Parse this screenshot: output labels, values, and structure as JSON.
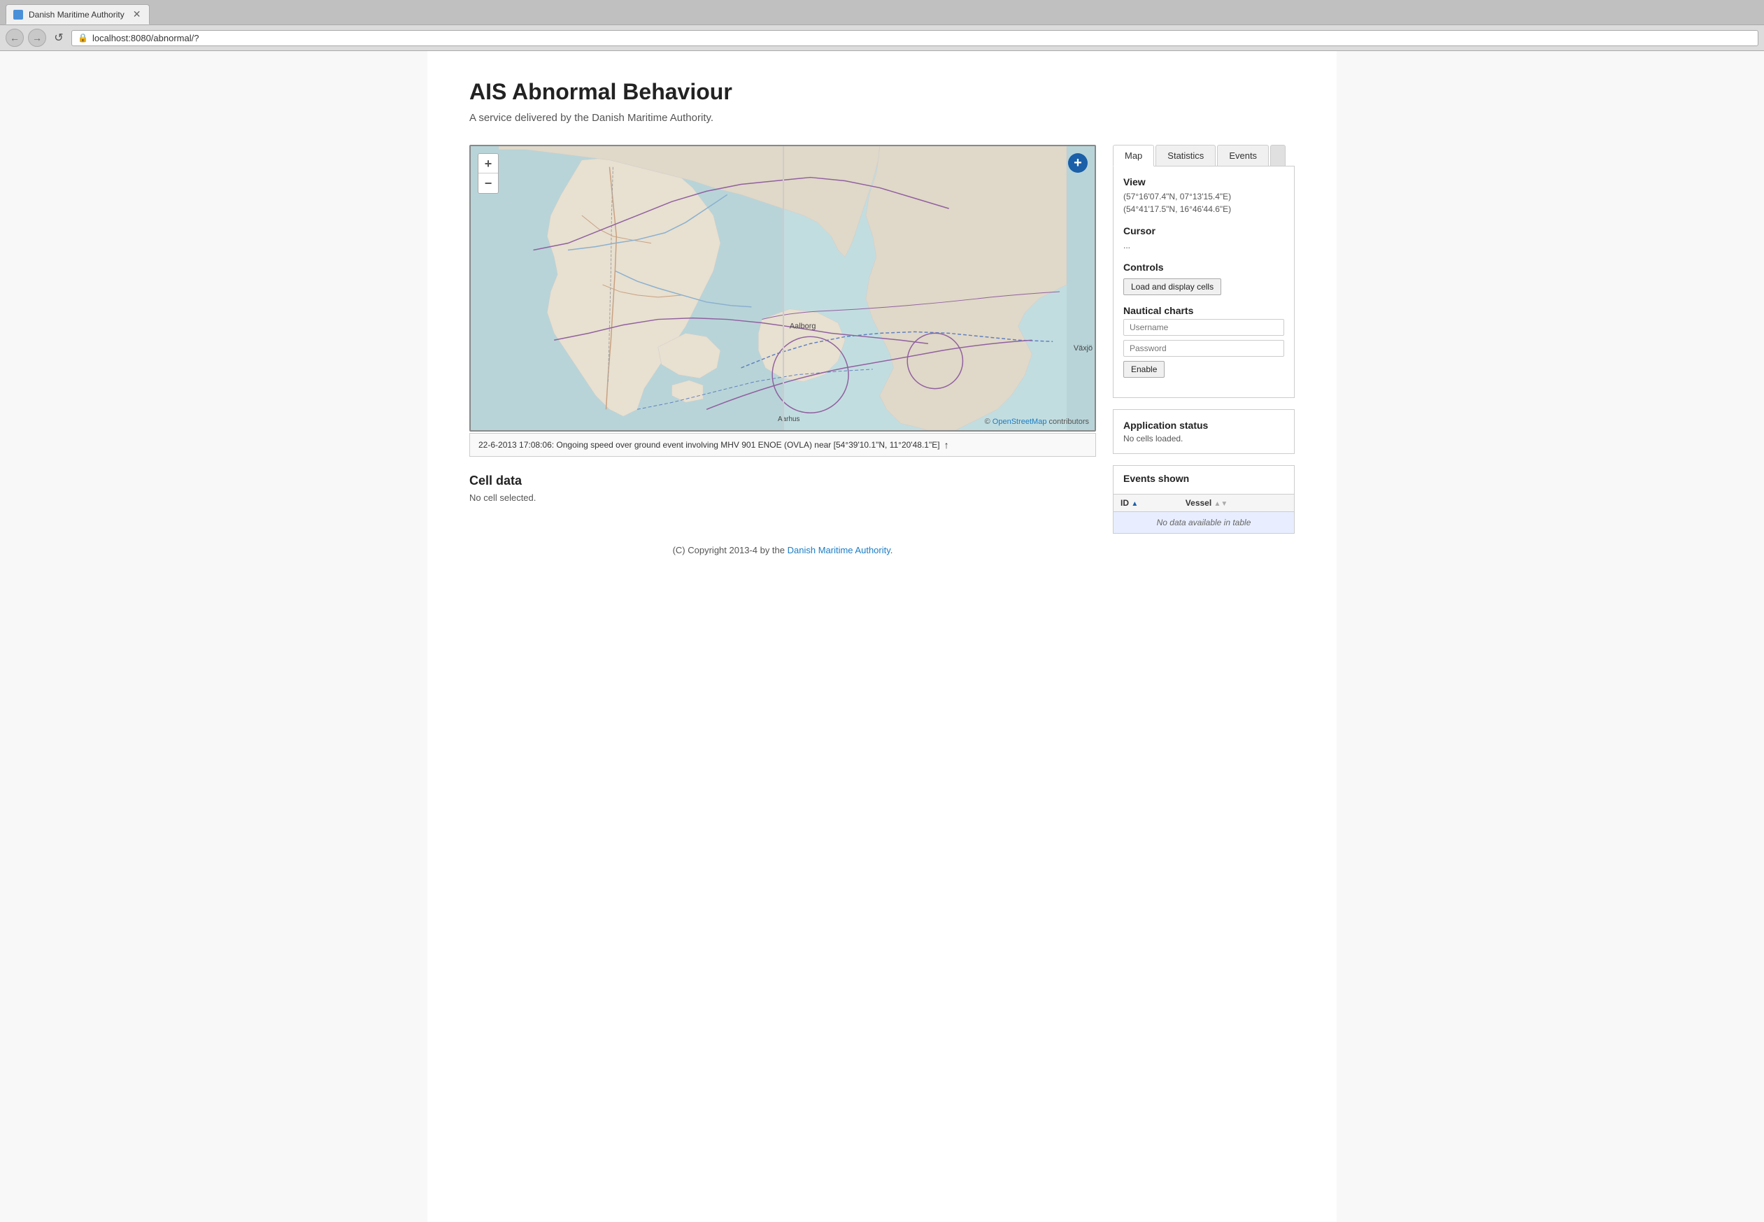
{
  "browser": {
    "tab_title": "Danish Maritime Authority",
    "url": "localhost:8080/abnormal/?",
    "favicon": "🌊"
  },
  "page": {
    "title": "AIS Abnormal Behaviour",
    "subtitle": "A service delivered by the Danish Maritime Authority.",
    "footer_text_before": "(C) Copyright 2013-4 by the ",
    "footer_link_text": "Danish Maritime Authority",
    "footer_text_after": "."
  },
  "map": {
    "zoom_in": "+",
    "zoom_out": "−",
    "plus_btn": "+",
    "attribution_text": "© OpenStreetMap contributors",
    "attribution_link": "OpenStreetMap",
    "divider": true
  },
  "event_bar": {
    "text": "22-6-2013 17:08:06: Ongoing speed over ground event involving MHV 901 ENOE (OVLA) near [54°39'10.1\"N, 11°20'48.1\"E]",
    "arrow": "↑"
  },
  "cell_data": {
    "title": "Cell data",
    "value": "No cell selected."
  },
  "panel": {
    "tabs": [
      {
        "label": "Map",
        "active": true
      },
      {
        "label": "Statistics",
        "active": false
      },
      {
        "label": "Events",
        "active": false
      }
    ],
    "view_section": {
      "title": "View",
      "line1": "(57°16'07.4\"N, 07°13'15.4\"E)",
      "line2": "(54°41'17.5\"N, 16°46'44.6\"E)"
    },
    "cursor_section": {
      "title": "Cursor",
      "value": "..."
    },
    "controls_section": {
      "title": "Controls",
      "button_label": "Load and display cells"
    },
    "nautical_charts_section": {
      "title": "Nautical charts",
      "username_placeholder": "Username",
      "password_placeholder": "Password",
      "enable_label": "Enable"
    }
  },
  "app_status": {
    "title": "Application status",
    "value": "No cells loaded."
  },
  "events_shown": {
    "title": "Events shown",
    "columns": [
      {
        "label": "ID",
        "sort": "asc"
      },
      {
        "label": "Vessel",
        "sort": "none"
      }
    ],
    "no_data_text": "No data available in table"
  }
}
